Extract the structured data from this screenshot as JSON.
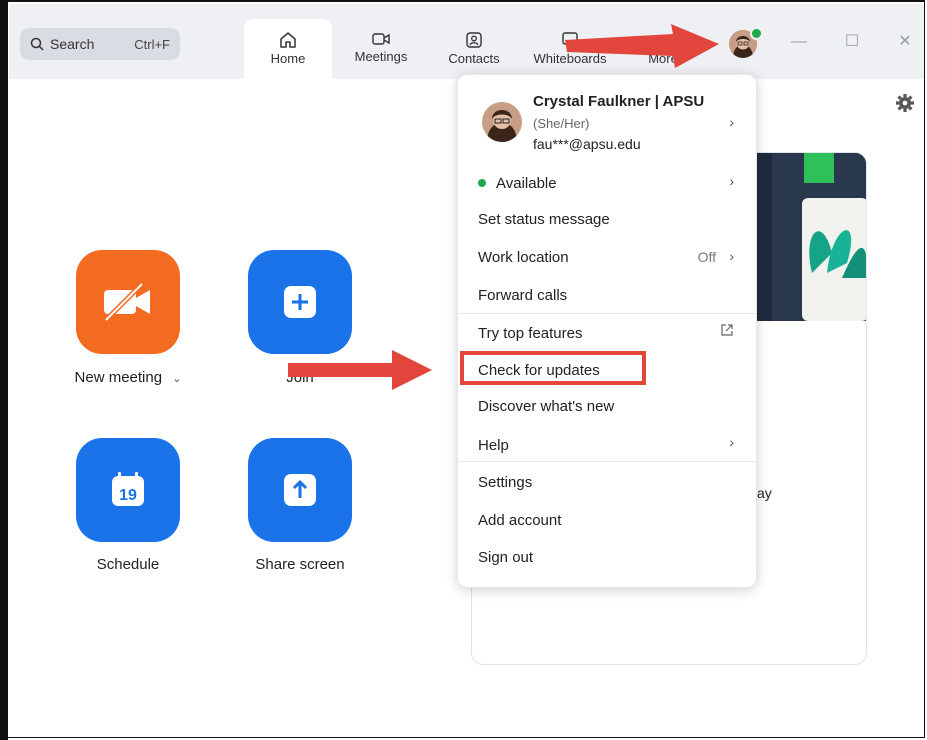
{
  "search": {
    "label": "Search",
    "shortcut": "Ctrl+F"
  },
  "tabs": [
    {
      "label": "Home"
    },
    {
      "label": "Meetings"
    },
    {
      "label": "Contacts"
    },
    {
      "label": "Whiteboards"
    },
    {
      "label": "More"
    }
  ],
  "actions": {
    "new_meeting": "New meeting",
    "join": "Join",
    "schedule": "Schedule",
    "schedule_day": "19",
    "share_screen": "Share screen"
  },
  "card": {
    "partial_text": "ay"
  },
  "menu": {
    "name": "Crystal Faulkner | APSU",
    "pronouns": "(She/Her)",
    "email": "fau***@apsu.edu",
    "status": "Available",
    "set_status": "Set status message",
    "work_location": "Work location",
    "work_location_value": "Off",
    "forward_calls": "Forward calls",
    "try_features": "Try top features",
    "check_updates": "Check for updates",
    "discover": "Discover what's new",
    "help": "Help",
    "settings": "Settings",
    "add_account": "Add account",
    "sign_out": "Sign out"
  },
  "colors": {
    "accent_blue": "#1a73e8",
    "orange": "#f26b21",
    "status_green": "#1ea84a",
    "annotation_red": "#e2453b"
  }
}
